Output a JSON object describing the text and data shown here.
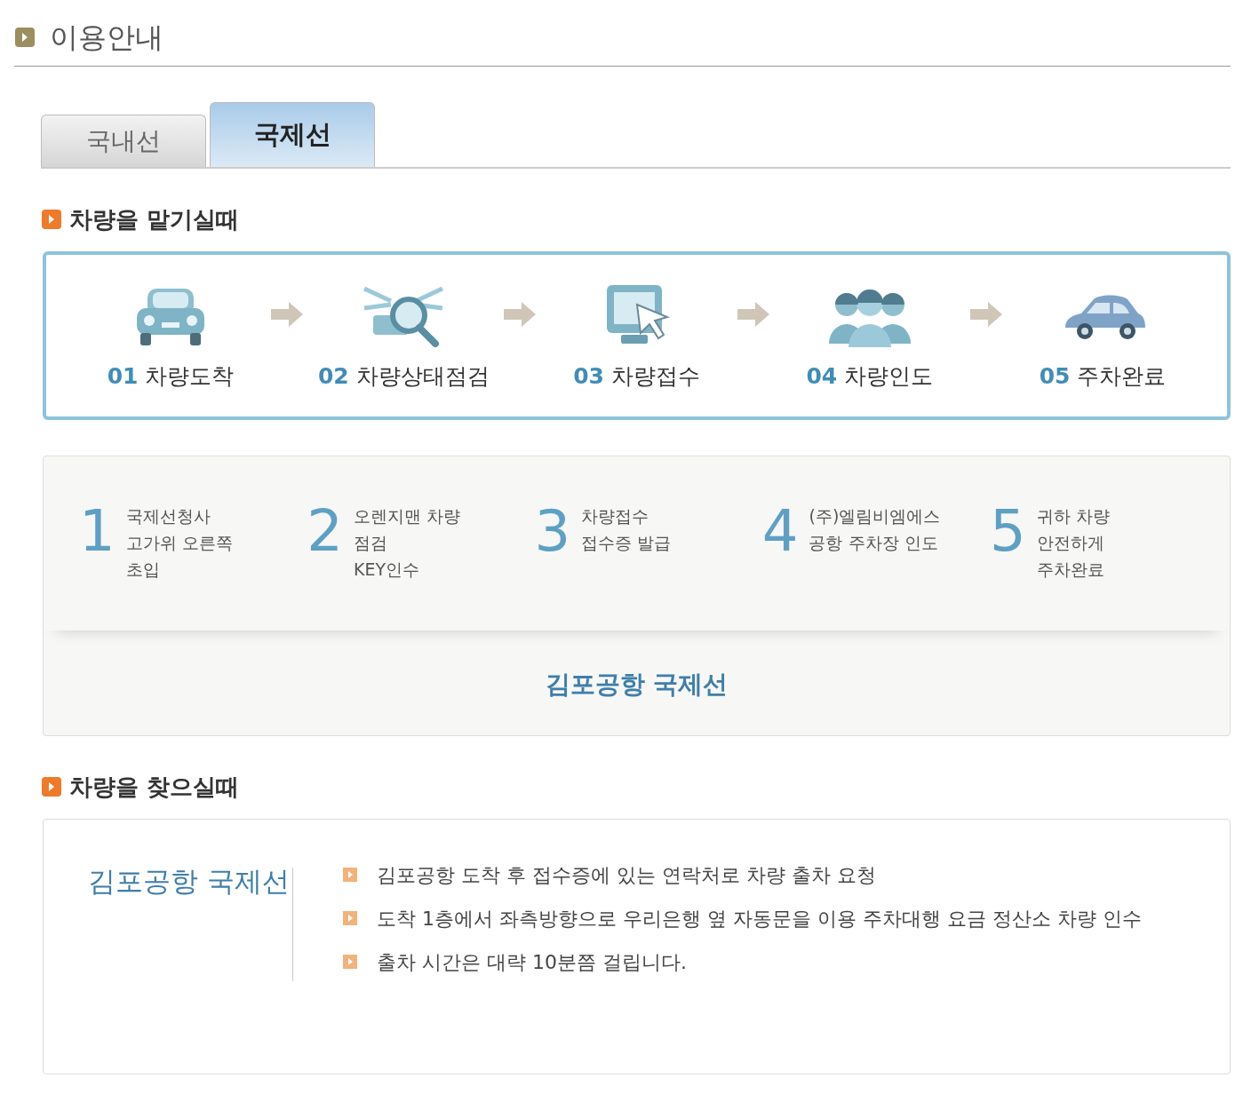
{
  "page_title": "이용안내",
  "tabs": [
    {
      "label": "국내선",
      "selected": false
    },
    {
      "label": "국제선",
      "selected": true
    }
  ],
  "dropoff": {
    "heading": "차량을 맡기실때",
    "steps": [
      {
        "kind": "car-front",
        "number": "01",
        "label": "차량도착"
      },
      {
        "kind": "inspect",
        "number": "02",
        "label": "차량상태점검"
      },
      {
        "kind": "monitor",
        "number": "03",
        "label": "차량접수"
      },
      {
        "kind": "people",
        "number": "04",
        "label": "차량인도"
      },
      {
        "kind": "car-side",
        "number": "05",
        "label": "주차완료"
      }
    ],
    "details": [
      {
        "number": "1",
        "text": "국제선청사\n고가위 오른쪽\n초입"
      },
      {
        "number": "2",
        "text": "오렌지맨 차량\n점검\nKEY인수"
      },
      {
        "number": "3",
        "text": "차량접수\n접수증 발급"
      },
      {
        "number": "4",
        "text": "(주)엘림비엠에스\n공항 주차장 인도"
      },
      {
        "number": "5",
        "text": "귀하 차량\n안전하게\n주차완료"
      }
    ],
    "caption": "김포공항 국제선"
  },
  "pickup": {
    "heading": "차량을 찾으실때",
    "place": "김포공항 국제선",
    "items": [
      "김포공항 도착 후 접수증에 있는 연락처로 차량 출차 요청",
      "도착 1층에서 좌측방향으로 우리은행 옆 자동문을 이용 주차대행 요금 정산소 차량 인수",
      "출차 시간은 대략 10분쯤 걸립니다."
    ]
  }
}
